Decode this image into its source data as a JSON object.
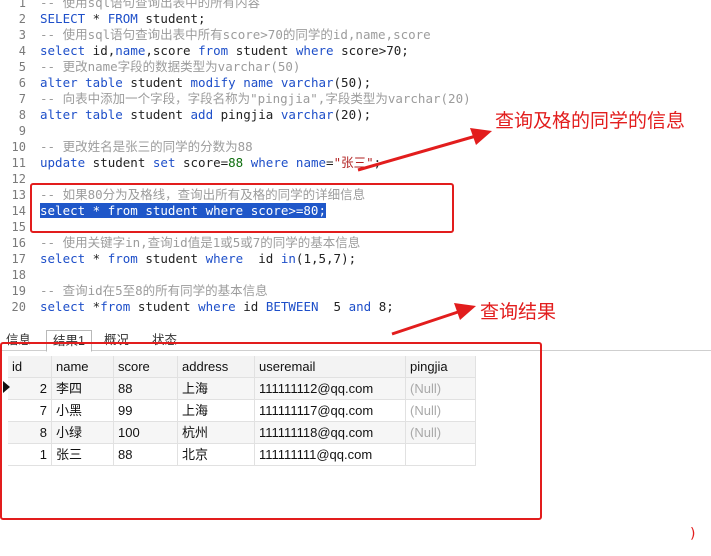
{
  "editor": {
    "lines": [
      {
        "n": "1",
        "tokens": [
          {
            "t": "-- 使用sql语句查询出表中的所有内容",
            "c": "cm"
          }
        ]
      },
      {
        "n": "2",
        "tokens": [
          {
            "t": "SELECT",
            "c": "kw"
          },
          {
            "t": " * ",
            "c": "tx"
          },
          {
            "t": "FROM",
            "c": "kw"
          },
          {
            "t": " student;",
            "c": "tx"
          }
        ]
      },
      {
        "n": "3",
        "tokens": [
          {
            "t": "-- 使用sql语句查询出表中所有score>70的同学的id,name,score",
            "c": "cm"
          }
        ]
      },
      {
        "n": "4",
        "tokens": [
          {
            "t": "select",
            "c": "kw"
          },
          {
            "t": " id,",
            "c": "tx"
          },
          {
            "t": "name",
            "c": "kw"
          },
          {
            "t": ",score ",
            "c": "tx"
          },
          {
            "t": "from",
            "c": "kw"
          },
          {
            "t": " student ",
            "c": "tx"
          },
          {
            "t": "where",
            "c": "kw"
          },
          {
            "t": " score>70;",
            "c": "tx"
          }
        ]
      },
      {
        "n": "5",
        "tokens": [
          {
            "t": "-- 更改name字段的数据类型为varchar(50)",
            "c": "cm"
          }
        ]
      },
      {
        "n": "6",
        "tokens": [
          {
            "t": "alter table",
            "c": "kw"
          },
          {
            "t": " student ",
            "c": "tx"
          },
          {
            "t": "modify name varchar",
            "c": "kw"
          },
          {
            "t": "(50);",
            "c": "tx"
          }
        ]
      },
      {
        "n": "7",
        "tokens": [
          {
            "t": "-- 向表中添加一个字段，字段名称为\"pingjia\",字段类型为varchar(20)",
            "c": "cm"
          }
        ]
      },
      {
        "n": "8",
        "tokens": [
          {
            "t": "alter table",
            "c": "kw"
          },
          {
            "t": " student ",
            "c": "tx"
          },
          {
            "t": "add",
            "c": "kw"
          },
          {
            "t": " pingjia ",
            "c": "tx"
          },
          {
            "t": "varchar",
            "c": "kw"
          },
          {
            "t": "(20);",
            "c": "tx"
          }
        ]
      },
      {
        "n": "9",
        "tokens": []
      },
      {
        "n": "10",
        "tokens": [
          {
            "t": "-- 更改姓名是张三的同学的分数为88",
            "c": "cm"
          }
        ]
      },
      {
        "n": "11",
        "tokens": [
          {
            "t": "update",
            "c": "kw"
          },
          {
            "t": " student ",
            "c": "tx"
          },
          {
            "t": "set",
            "c": "kw"
          },
          {
            "t": " score=",
            "c": "tx"
          },
          {
            "t": "88",
            "c": "num"
          },
          {
            "t": " ",
            "c": "tx"
          },
          {
            "t": "where",
            "c": "kw"
          },
          {
            "t": " ",
            "c": "tx"
          },
          {
            "t": "name",
            "c": "kw"
          },
          {
            "t": "=",
            "c": "tx"
          },
          {
            "t": "\"张三\"",
            "c": "str"
          },
          {
            "t": ";",
            "c": "tx"
          }
        ]
      },
      {
        "n": "12",
        "tokens": []
      },
      {
        "n": "13",
        "tokens": [
          {
            "t": "-- 如果80分为及格线，查询出所有及格的同学的详细信息",
            "c": "cm"
          }
        ]
      },
      {
        "n": "14",
        "selected": true,
        "tokens": [
          {
            "t": "select * from student where score>=80;",
            "c": "sel"
          }
        ]
      },
      {
        "n": "15",
        "tokens": []
      },
      {
        "n": "16",
        "tokens": [
          {
            "t": "-- 使用关键字in,查询id值是1或5或7的同学的基本信息",
            "c": "cm"
          }
        ]
      },
      {
        "n": "17",
        "tokens": [
          {
            "t": "select",
            "c": "kw"
          },
          {
            "t": " * ",
            "c": "tx"
          },
          {
            "t": "from",
            "c": "kw"
          },
          {
            "t": " student ",
            "c": "tx"
          },
          {
            "t": "where",
            "c": "kw"
          },
          {
            "t": "  id ",
            "c": "tx"
          },
          {
            "t": "in",
            "c": "kw"
          },
          {
            "t": "(1,5,7);",
            "c": "tx"
          }
        ]
      },
      {
        "n": "18",
        "tokens": []
      },
      {
        "n": "19",
        "tokens": [
          {
            "t": "-- 查询id在5至8的所有同学的基本信息",
            "c": "cm"
          }
        ]
      },
      {
        "n": "20",
        "tokens": [
          {
            "t": "select",
            "c": "kw"
          },
          {
            "t": " *",
            "c": "tx"
          },
          {
            "t": "from",
            "c": "kw"
          },
          {
            "t": " student ",
            "c": "tx"
          },
          {
            "t": "where",
            "c": "kw"
          },
          {
            "t": " id ",
            "c": "tx"
          },
          {
            "t": "BETWEEN",
            "c": "kw"
          },
          {
            "t": "  5 ",
            "c": "tx"
          },
          {
            "t": "and",
            "c": "kw"
          },
          {
            "t": " 8;",
            "c": "tx"
          }
        ]
      }
    ]
  },
  "tabs": [
    {
      "label": "信息",
      "active": false
    },
    {
      "label": "结果1",
      "active": true
    },
    {
      "label": "概况",
      "active": false
    },
    {
      "label": "状态",
      "active": false
    }
  ],
  "results": {
    "columns": [
      "id",
      "name",
      "score",
      "address",
      "useremail",
      "pingjia"
    ],
    "rows": [
      [
        "2",
        "李四",
        "88",
        "上海",
        "111111112@qq.com",
        "(Null)"
      ],
      [
        "7",
        "小黑",
        "99",
        "上海",
        "111111117@qq.com",
        "(Null)"
      ],
      [
        "8",
        "小绿",
        "100",
        "杭州",
        "111111118@qq.com",
        "(Null)"
      ],
      [
        "1",
        "张三",
        "88",
        "北京",
        "111111111@qq.com",
        ""
      ]
    ]
  },
  "annotations": {
    "query_label": "查询及格的同学的信息",
    "result_label": "查询结果",
    "stray_mark": ")"
  },
  "colors": {
    "annotation": "#e21d1d",
    "selection": "#1f57c9",
    "keyword": "#1e4fc9",
    "comment": "#9c9c9c"
  },
  "icons": {
    "row_cursor": "current-row-triangle-icon"
  }
}
